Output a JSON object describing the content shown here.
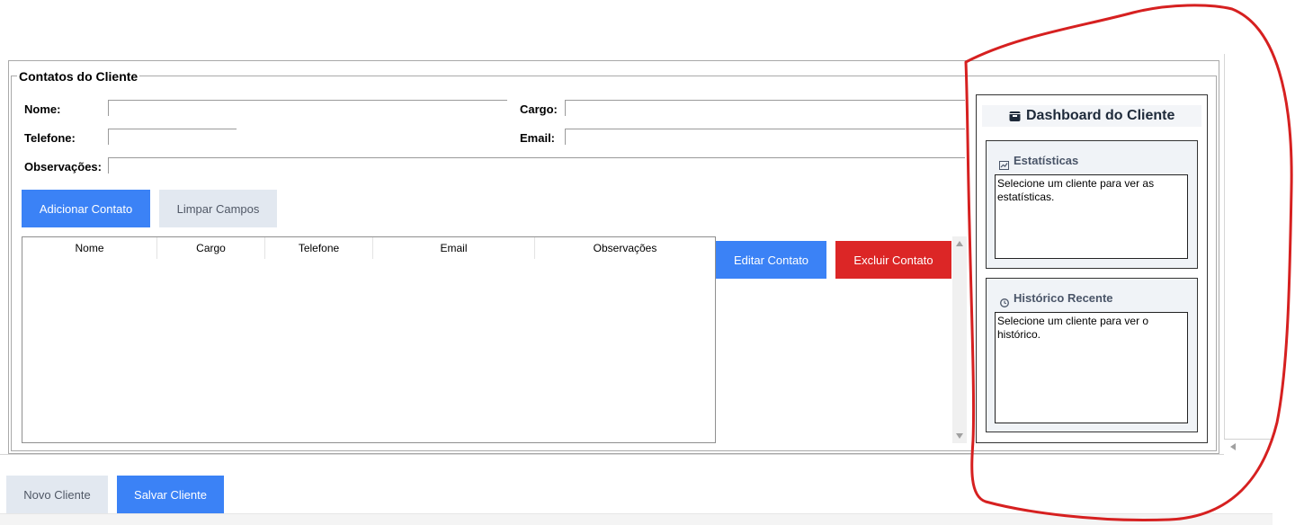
{
  "section": {
    "title": "Contatos do Cliente"
  },
  "form": {
    "nome_label": "Nome:",
    "cargo_label": "Cargo:",
    "telefone_label": "Telefone:",
    "email_label": "Email:",
    "observacoes_label": "Observações:",
    "nome_value": "",
    "cargo_value": "",
    "telefone_value": "",
    "email_value": "",
    "observacoes_value": ""
  },
  "actions": {
    "add_contact": "Adicionar Contato",
    "clear_fields": "Limpar Campos",
    "edit_contact": "Editar Contato",
    "delete_contact": "Excluir Contato"
  },
  "table": {
    "columns": [
      "Nome",
      "Cargo",
      "Telefone",
      "Email",
      "Observações"
    ],
    "rows": []
  },
  "dashboard": {
    "title": "Dashboard do Cliente",
    "stats": {
      "title": "Estatísticas",
      "text": "Selecione um cliente para ver as estatísticas."
    },
    "history": {
      "title": "Histórico Recente",
      "text": "Selecione um cliente para ver o histórico."
    }
  },
  "footer": {
    "new_client": "Novo Cliente",
    "save_client": "Salvar Cliente"
  },
  "colors": {
    "primary": "#3b82f6",
    "danger": "#dc2626",
    "secondary": "#e2e8f0",
    "annotation": "#d62020"
  },
  "icons": {
    "dashboard": "dashboard-icon",
    "stats": "chart-icon",
    "history": "clock-icon"
  }
}
